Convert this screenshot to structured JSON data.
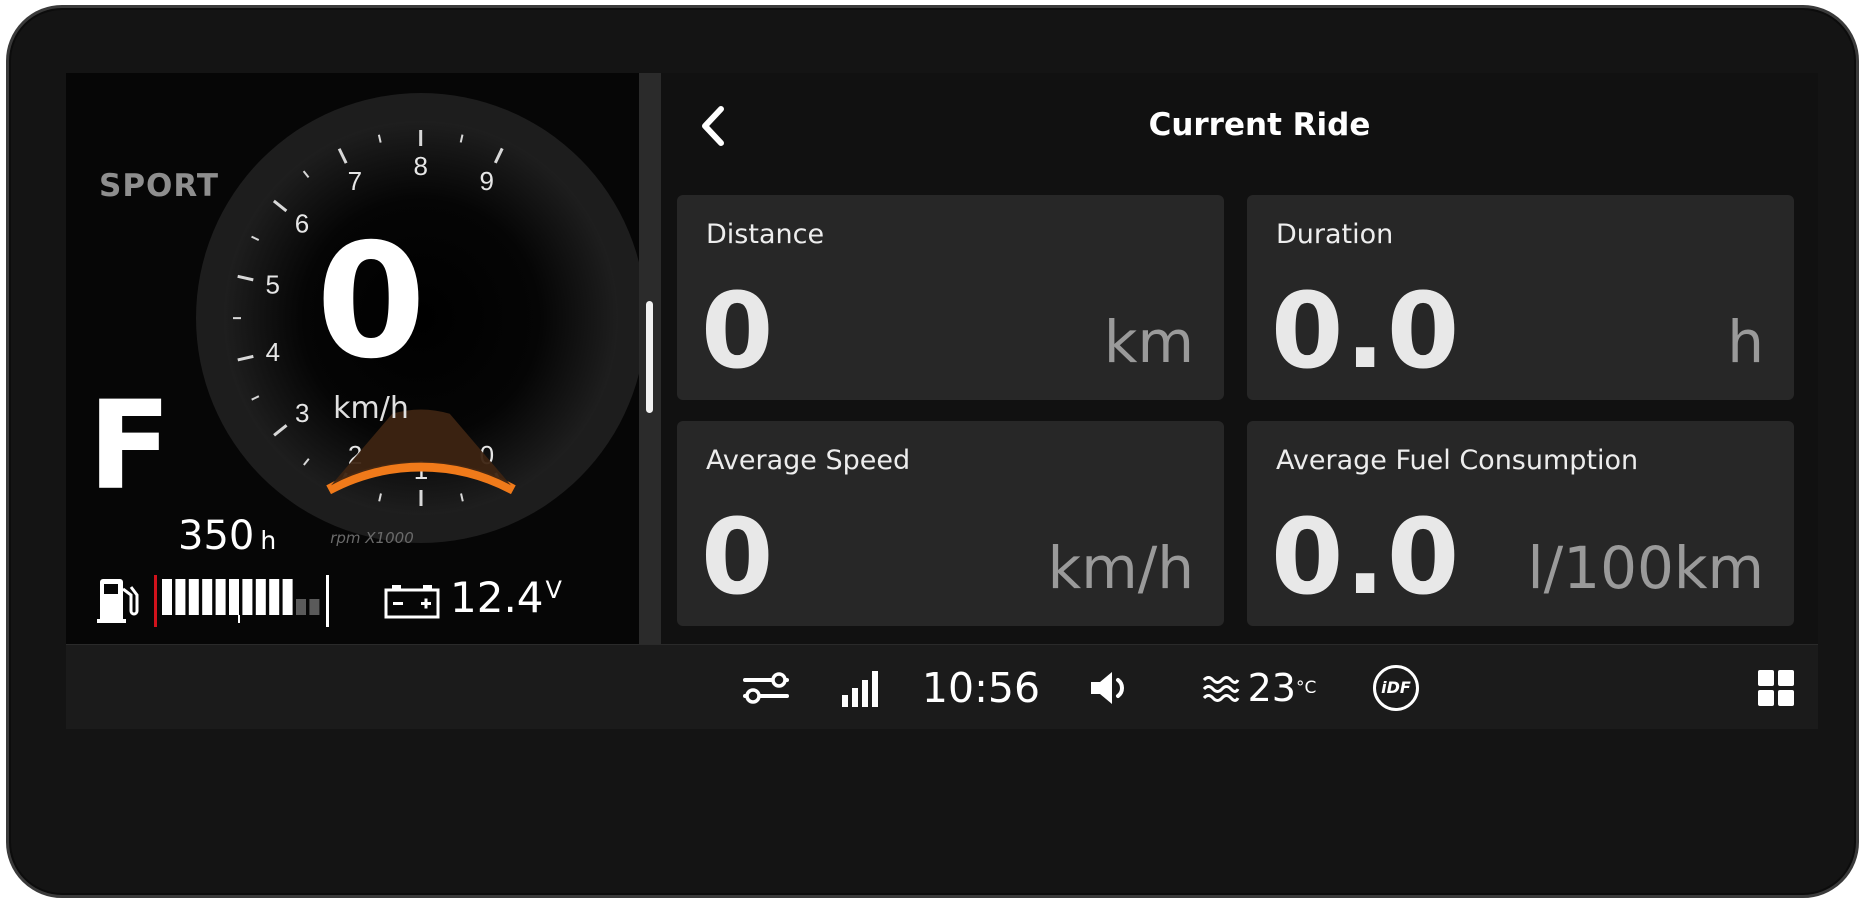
{
  "cluster": {
    "mode": "SPORT",
    "gear": "F",
    "speed": "0",
    "speed_unit": "km/h",
    "rpm_label": "rpm X1000",
    "rpm_ticks": [
      "0",
      "1",
      "2",
      "3",
      "4",
      "5",
      "6",
      "7",
      "8",
      "9"
    ],
    "rpm_value": 0,
    "engine_hours": "350",
    "engine_hours_unit": "h",
    "fuel_level_segments": 10,
    "fuel_total_segments": 12,
    "battery_voltage": "12.4",
    "battery_unit": "V",
    "accent_color": "#f07a1a"
  },
  "panel": {
    "title": "Current Ride",
    "back_icon": "chevron-left-icon",
    "cards": [
      {
        "label": "Distance",
        "value": "0",
        "unit": "km"
      },
      {
        "label": "Duration",
        "value": "0.0",
        "unit": "h"
      },
      {
        "label": "Average Speed",
        "value": "0",
        "unit": "km/h"
      },
      {
        "label": "Average Fuel Consumption",
        "value": "0.0",
        "unit": "l/100km"
      }
    ]
  },
  "statusbar": {
    "settings_icon": "toggles-icon",
    "signal_icon": "signal-bars-icon",
    "time": "10:56",
    "volume_icon": "speaker-icon",
    "water_temp_icon": "water-waves-icon",
    "water_temp": "23",
    "water_temp_unit": "°C",
    "idf_label": "iDF",
    "apps_icon": "grid-icon"
  }
}
